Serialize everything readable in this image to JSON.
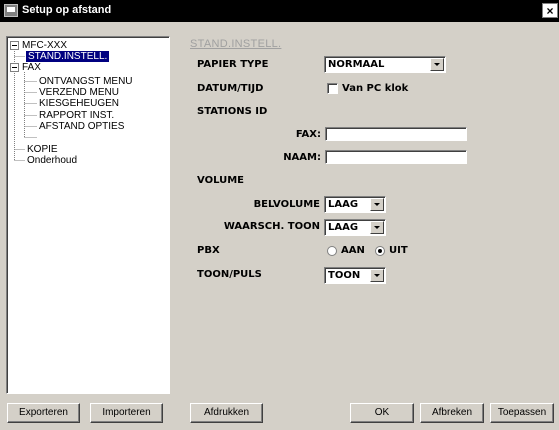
{
  "window": {
    "title": "Setup op afstand",
    "close_label": "×"
  },
  "tree": {
    "root": "MFC-XXX",
    "items": {
      "stand_instell": "STAND.INSTELL.",
      "fax": "FAX",
      "ontvangst": "ONTVANGST MENU",
      "verzend": "VERZEND MENU",
      "kiesgeheugen": "KIESGEHEUGEN",
      "rapport": "RAPPORT INST.",
      "afstand": "AFSTAND OPTIES",
      "kopie": "KOPIE",
      "onderhoud": "Onderhoud"
    }
  },
  "main": {
    "section_title": "STAND.INSTELL.",
    "papier_type": {
      "label": "PAPIER TYPE",
      "value": "NORMAAL"
    },
    "datum_tijd": {
      "label": "DATUM/TIJD",
      "checkbox_label": "Van PC klok",
      "checked": false
    },
    "stations_id": {
      "label": "STATIONS ID",
      "fax_label": "FAX:",
      "fax_value": "",
      "naam_label": "NAAM:",
      "naam_value": ""
    },
    "volume": {
      "label": "VOLUME",
      "belvolume_label": "BELVOLUME",
      "belvolume_value": "LAAG",
      "waarsch_label": "WAARSCH. TOON",
      "waarsch_value": "LAAG"
    },
    "pbx": {
      "label": "PBX",
      "aan": "AAN",
      "uit": "UIT",
      "selected": "UIT"
    },
    "toon_puls": {
      "label": "TOON/PULS",
      "value": "TOON"
    }
  },
  "buttons": {
    "exporteren": "Exporteren",
    "importeren": "Importeren",
    "afdrukken": "Afdrukken",
    "ok": "OK",
    "afbreken": "Afbreken",
    "toepassen": "Toepassen"
  }
}
